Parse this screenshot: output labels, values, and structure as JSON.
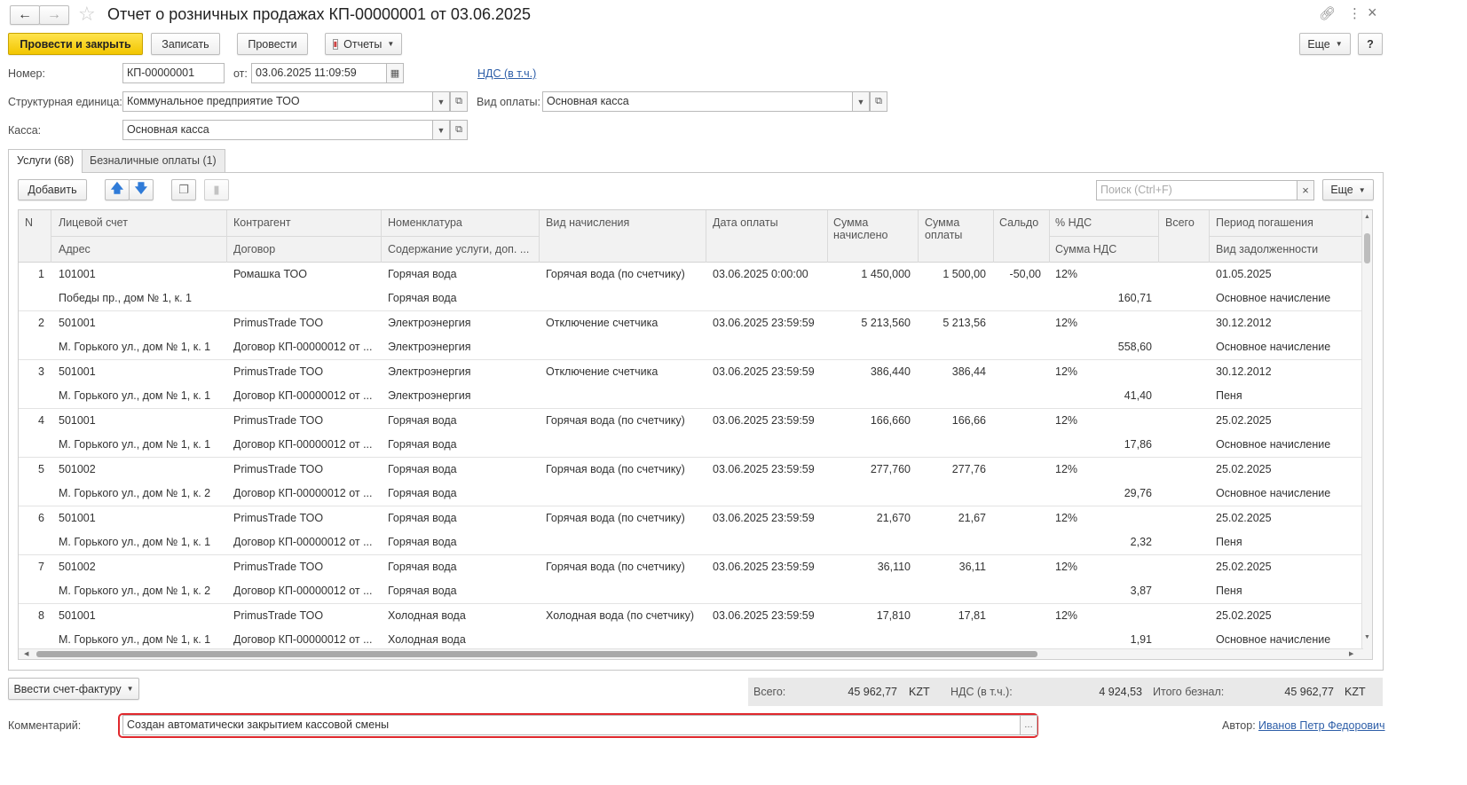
{
  "window": {
    "title": "Отчет о розничных продажах КП-00000001 от 03.06.2025"
  },
  "toolbar": {
    "post_close": "Провести и закрыть",
    "save": "Записать",
    "post": "Провести",
    "reports": "Отчеты",
    "more": "Еще",
    "help": "?"
  },
  "form": {
    "number_label": "Номер:",
    "number_value": "КП-00000001",
    "date_label": "от:",
    "date_value": "03.06.2025 11:09:59",
    "vat_link": "НДС (в т.ч.)",
    "unit_label": "Структурная единица:",
    "unit_value": "Коммунальное предприятие ТОО",
    "paytype_label": "Вид оплаты:",
    "paytype_value": "Основная касса",
    "cash_label": "Касса:",
    "cash_value": "Основная касса"
  },
  "tabs": [
    {
      "label": "Услуги (68)"
    },
    {
      "label": "Безналичные оплаты (1)"
    }
  ],
  "table_toolbar": {
    "add": "Добавить",
    "search_placeholder": "Поиск (Ctrl+F)",
    "clear": "×",
    "more": "Еще"
  },
  "columns": {
    "n": "N",
    "account": "Лицевой счет",
    "address": "Адрес",
    "counterparty": "Контрагент",
    "contract": "Договор",
    "nomenclature": "Номенклатура",
    "content": "Содержание услуги, доп. ...",
    "charge_type": "Вид начисления",
    "pay_date": "Дата оплаты",
    "charged": "Сумма начислено",
    "paid": "Сумма оплаты",
    "saldo": "Сальдо",
    "vat_rate": "% НДС",
    "vat_sum": "Сумма НДС",
    "total": "Всего",
    "period": "Период погашения",
    "debt_type": "Вид задолженности"
  },
  "rows": [
    {
      "n": "1",
      "account": "101001",
      "address": "Победы пр., дом № 1, к. 1",
      "counterparty": "Ромашка ТОО",
      "contract": "",
      "nomenclature": "Горячая вода",
      "content": "Горячая вода",
      "charge_type": "Горячая вода (по счетчику)",
      "pay_date": "03.06.2025 0:00:00",
      "charged": "1 450,000",
      "paid": "1 500,00",
      "saldo": "-50,00",
      "vat_rate": "12%",
      "vat_sum": "160,71",
      "period": "01.05.2025",
      "debt_type": "Основное начисление"
    },
    {
      "n": "2",
      "account": "501001",
      "address": "М. Горького ул., дом № 1, к. 1",
      "counterparty": "PrimusTrade ТОО",
      "contract": "Договор КП-00000012 от ...",
      "nomenclature": "Электроэнергия",
      "content": "Электроэнергия",
      "charge_type": "Отключение счетчика",
      "pay_date": "03.06.2025 23:59:59",
      "charged": "5 213,560",
      "paid": "5 213,56",
      "saldo": "",
      "vat_rate": "12%",
      "vat_sum": "558,60",
      "period": "30.12.2012",
      "debt_type": "Основное начисление"
    },
    {
      "n": "3",
      "account": "501001",
      "address": "М. Горького ул., дом № 1, к. 1",
      "counterparty": "PrimusTrade ТОО",
      "contract": "Договор КП-00000012 от ...",
      "nomenclature": "Электроэнергия",
      "content": "Электроэнергия",
      "charge_type": "Отключение счетчика",
      "pay_date": "03.06.2025 23:59:59",
      "charged": "386,440",
      "paid": "386,44",
      "saldo": "",
      "vat_rate": "12%",
      "vat_sum": "41,40",
      "period": "30.12.2012",
      "debt_type": "Пеня"
    },
    {
      "n": "4",
      "account": "501001",
      "address": "М. Горького ул., дом № 1, к. 1",
      "counterparty": "PrimusTrade ТОО",
      "contract": "Договор КП-00000012 от ...",
      "nomenclature": "Горячая вода",
      "content": "Горячая вода",
      "charge_type": "Горячая вода (по счетчику)",
      "pay_date": "03.06.2025 23:59:59",
      "charged": "166,660",
      "paid": "166,66",
      "saldo": "",
      "vat_rate": "12%",
      "vat_sum": "17,86",
      "period": "25.02.2025",
      "debt_type": "Основное начисление"
    },
    {
      "n": "5",
      "account": "501002",
      "address": "М. Горького ул., дом № 1, к. 2",
      "counterparty": "PrimusTrade ТОО",
      "contract": "Договор КП-00000012 от ...",
      "nomenclature": "Горячая вода",
      "content": "Горячая вода",
      "charge_type": "Горячая вода (по счетчику)",
      "pay_date": "03.06.2025 23:59:59",
      "charged": "277,760",
      "paid": "277,76",
      "saldo": "",
      "vat_rate": "12%",
      "vat_sum": "29,76",
      "period": "25.02.2025",
      "debt_type": "Основное начисление"
    },
    {
      "n": "6",
      "account": "501001",
      "address": "М. Горького ул., дом № 1, к. 1",
      "counterparty": "PrimusTrade ТОО",
      "contract": "Договор КП-00000012 от ...",
      "nomenclature": "Горячая вода",
      "content": "Горячая вода",
      "charge_type": "Горячая вода (по счетчику)",
      "pay_date": "03.06.2025 23:59:59",
      "charged": "21,670",
      "paid": "21,67",
      "saldo": "",
      "vat_rate": "12%",
      "vat_sum": "2,32",
      "period": "25.02.2025",
      "debt_type": "Пеня"
    },
    {
      "n": "7",
      "account": "501002",
      "address": "М. Горького ул., дом № 1, к. 2",
      "counterparty": "PrimusTrade ТОО",
      "contract": "Договор КП-00000012 от ...",
      "nomenclature": "Горячая вода",
      "content": "Горячая вода",
      "charge_type": "Горячая вода (по счетчику)",
      "pay_date": "03.06.2025 23:59:59",
      "charged": "36,110",
      "paid": "36,11",
      "saldo": "",
      "vat_rate": "12%",
      "vat_sum": "3,87",
      "period": "25.02.2025",
      "debt_type": "Пеня"
    },
    {
      "n": "8",
      "account": "501001",
      "address": "М. Горького ул., дом № 1, к. 1",
      "counterparty": "PrimusTrade ТОО",
      "contract": "Договор КП-00000012 от ...",
      "nomenclature": "Холодная вода",
      "content": "Холодная вода",
      "charge_type": "Холодная вода (по счетчику)",
      "pay_date": "03.06.2025 23:59:59",
      "charged": "17,810",
      "paid": "17,81",
      "saldo": "",
      "vat_rate": "12%",
      "vat_sum": "1,91",
      "period": "25.02.2025",
      "debt_type": "Основное начисление"
    }
  ],
  "footer": {
    "invoice_button": "Ввести счет-фактуру",
    "total_label": "Всего:",
    "total_value": "45 962,77",
    "currency": "KZT",
    "vat_label": "НДС (в т.ч.):",
    "vat_value": "4 924,53",
    "noncash_label": "Итого безнал:",
    "noncash_value": "45 962,77",
    "currency2": "KZT",
    "comment_label": "Комментарий:",
    "comment_value": "Создан автоматически закрытием кассовой смены",
    "author_label": "Автор:",
    "author_value": "Иванов Петр Федорович"
  },
  "colors": {
    "primary_button": "#f5cd0f",
    "link": "#2d5ea8",
    "highlight_border": "#e0282d",
    "grid_header": "#f2f2f2"
  }
}
